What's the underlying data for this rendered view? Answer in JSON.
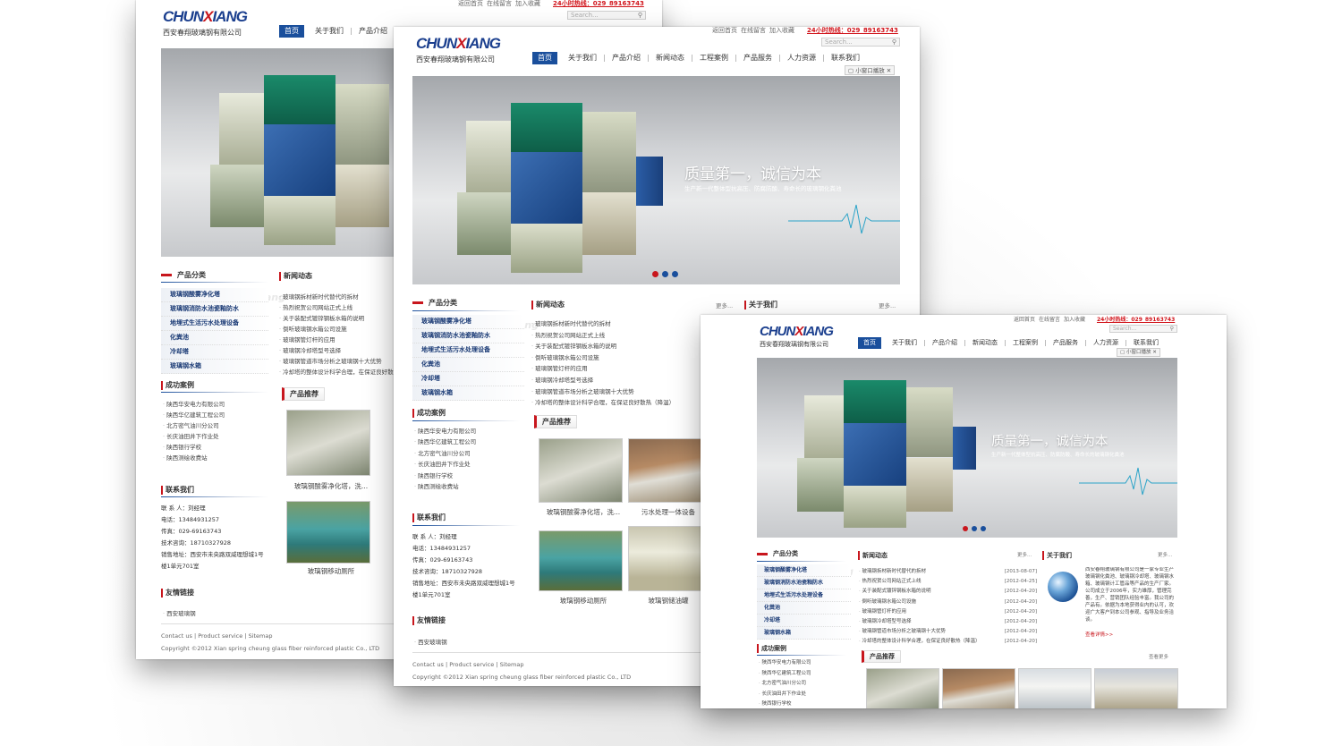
{
  "site": {
    "logo_main": "CHUN",
    "logo_x": "X",
    "logo_rest": "IANG",
    "company": "西安春翔玻璃钢有限公司",
    "top_links": [
      "返回首页",
      "在线留言",
      "加入收藏"
    ],
    "hotline": "24小时热线：029_89163743",
    "search_placeholder": "Search...",
    "nav": [
      "首页",
      "关于我们",
      "产品介绍",
      "新闻动态",
      "工程案例",
      "产品服务",
      "人力资源",
      "联系我们"
    ],
    "small_window": "小窗口播放",
    "slogan": "质量第一，诚信为本",
    "slogan_sub": "生产新一代整体型抗高压、防腐防酸、寿命长的玻璃钢化粪池",
    "sections": {
      "products": "产品分类",
      "news": "新闻动态",
      "about": "关于我们",
      "cases": "成功案例",
      "contact": "联系我们",
      "recommend": "产品推荐",
      "links": "友情链接"
    },
    "more": "更多...",
    "view_more": "查看更多",
    "categories": [
      "玻璃钢酸雾净化塔",
      "玻璃钢消防水池瓷釉防水",
      "地埋式生活污水处理设备",
      "化粪池",
      "冷却塔",
      "玻璃钢水箱"
    ],
    "watermark": "ChunXiang",
    "news": [
      "玻璃钢拆材新时代替代的拆材",
      "热烈祝贺公司网站正式上线",
      "关于装配式镀锌钢板水箱的说明",
      "倒听玻璃钢水箱公司设施",
      "玻璃钢管灯杆的应用",
      "玻璃钢冷却塔型号选择",
      "玻璃钢管道市场分析之玻璃钢十大优势",
      "冷却塔的整体设计科学合理，在保证良好散热（降温）"
    ],
    "news_dates": [
      "[2013-08-07]",
      "[2012-04-25]",
      "[2012-04-20]",
      "[2012-04-20]",
      "[2012-04-20]",
      "[2012-04-20]",
      "[2012-04-20]",
      "[2012-04-20]"
    ],
    "cases": [
      "陕西华安电力有限公司",
      "陕西华亿建筑工程公司",
      "北方密气油川分公司",
      "长庆油田井下作业处",
      "陕西银行学校",
      "陕西测绘收费站"
    ],
    "contact": [
      "联 系 人：刘经理",
      "电话：13484931257",
      "传真：029-69163743",
      "技术咨询：18710327928",
      "销售地址：西安市未央路双威理想城1号",
      "楼1单元701室"
    ],
    "products": [
      {
        "caption": "玻璃钢酸雾净化塔，洗..."
      },
      {
        "caption": "污水处理一体设备"
      },
      {
        "caption": "玻璃钢移动厕所"
      },
      {
        "caption": "玻璃钢储油罐"
      }
    ],
    "links": [
      "西安玻璃钢"
    ],
    "about_text": "西安春翔玻璃钢有限公司是一家专业生产玻璃钢化粪池、玻璃钢冷却塔、玻璃钢水箱、玻璃钢计工管品等产品的生产厂家。公司成立于2006年，实力雄厚，管理完善，生产、营销团队经验丰富。我公司的产品有。依据为本地获得业内的认可，欢迎广大客户到本公司参观、指导及业务洽谈。",
    "about_more": "查看详情>>",
    "footer_links": [
      "Contact us",
      "Product service",
      "Sitemap"
    ],
    "copyright": "Copyright ©2012 Xian spring cheung glass fiber reinforced plastic Co., LTD"
  },
  "colors": {
    "brand": "#1a4f9c",
    "accent": "#c8161d",
    "dot_active": "#c8161d",
    "dot_inactive": "#1a4f9c"
  }
}
